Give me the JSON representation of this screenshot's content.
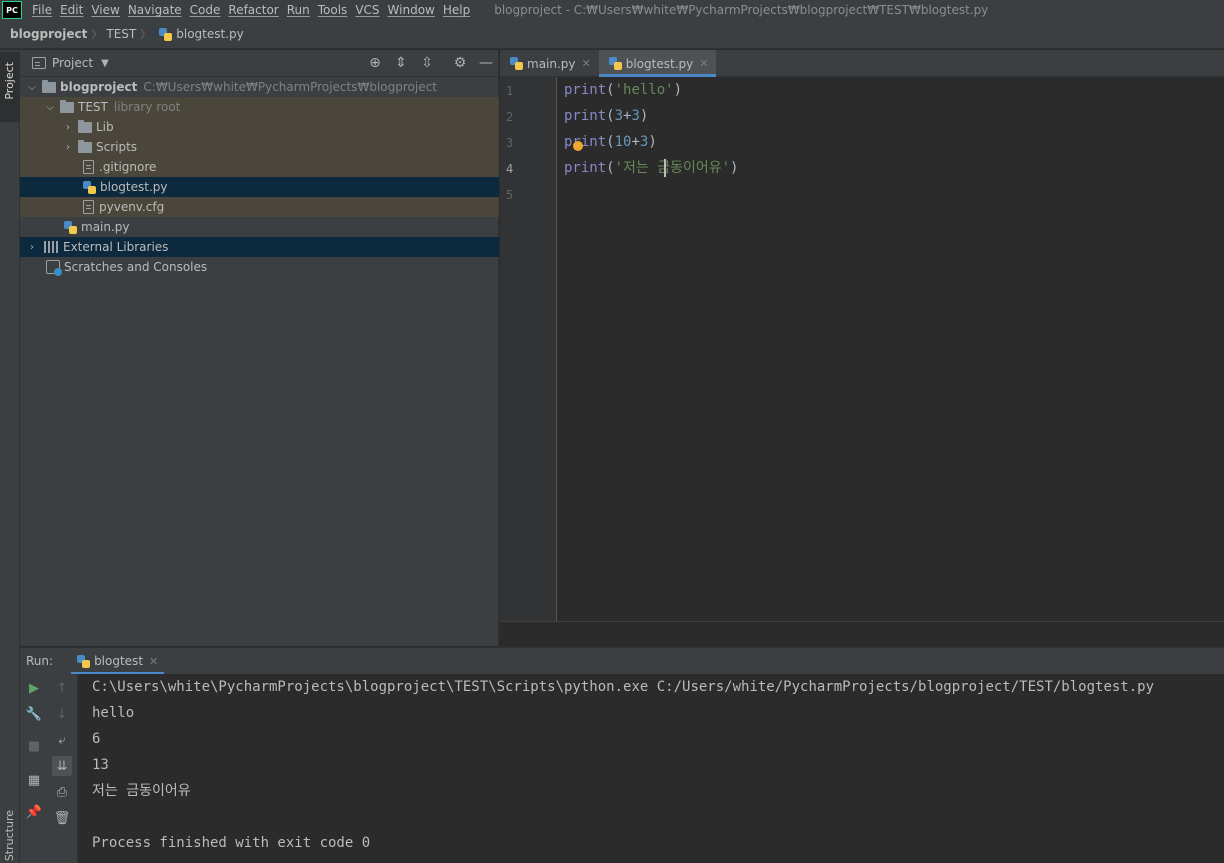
{
  "menubar": {
    "logo": "PC",
    "items": [
      "File",
      "Edit",
      "View",
      "Navigate",
      "Code",
      "Refactor",
      "Run",
      "Tools",
      "VCS",
      "Window",
      "Help"
    ],
    "window_title": "blogproject - C:₩Users₩white₩PycharmProjects₩blogproject₩TEST₩blogtest.py"
  },
  "breadcrumb": [
    "blogproject",
    "TEST",
    "blogtest.py"
  ],
  "left_stripe": {
    "project": "Project",
    "structure": "Structure"
  },
  "project_panel": {
    "title": "Project",
    "tree": [
      {
        "label": "blogproject",
        "hint": "C:₩Users₩white₩PycharmProjects₩blogproject"
      },
      {
        "label": "TEST",
        "hint": "library root"
      },
      {
        "label": "Lib"
      },
      {
        "label": "Scripts"
      },
      {
        "label": ".gitignore"
      },
      {
        "label": "blogtest.py"
      },
      {
        "label": "pyvenv.cfg"
      },
      {
        "label": "main.py"
      },
      {
        "label": "External Libraries"
      },
      {
        "label": "Scratches and Consoles"
      }
    ]
  },
  "editor": {
    "tabs": [
      {
        "label": "main.py",
        "active": false
      },
      {
        "label": "blogtest.py",
        "active": true
      }
    ],
    "line_numbers": [
      "1",
      "2",
      "3",
      "4",
      "5"
    ],
    "code": [
      {
        "fn": "print",
        "open": "(",
        "arg": "'hello'",
        "close": ")"
      },
      {
        "fn": "print",
        "open": "(",
        "a": "3",
        "op": "+",
        "b": "3",
        "close": ")"
      },
      {
        "fn": "print",
        "open": "(",
        "a": "10",
        "op": "+",
        "b": "3",
        "close": ")"
      },
      {
        "fn": "print",
        "open": "(",
        "arg": "'저는 금동이어유'",
        "close": ")"
      }
    ]
  },
  "run_panel": {
    "label": "Run:",
    "tab": "blogtest",
    "output": [
      "C:\\Users\\white\\PycharmProjects\\blogproject\\TEST\\Scripts\\python.exe C:/Users/white/PycharmProjects/blogproject/TEST/blogtest.py",
      "hello",
      "6",
      "13",
      "저는 금동이어유",
      "",
      "Process finished with exit code 0"
    ]
  },
  "colors": {
    "keyword": "#8888c6",
    "string": "#6a8759",
    "number": "#6897bb",
    "selection": "#0d293e",
    "library_root_bg": "#4b463c",
    "tab_underline": "#4a88c7"
  },
  "icons": [
    "locate-icon",
    "expand-all-icon",
    "collapse-all-icon",
    "gear-icon",
    "hide-icon",
    "run-icon",
    "wrench-icon",
    "stop-icon",
    "pin-icon",
    "trash-icon",
    "print-icon",
    "soft-wrap-icon",
    "scroll-to-end-icon",
    "up-arrow-icon",
    "down-arrow-icon",
    "layout-icon"
  ]
}
